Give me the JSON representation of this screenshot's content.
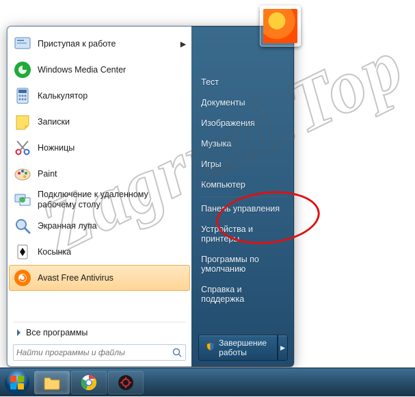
{
  "left_panel": {
    "items": [
      {
        "label": "Приступая к работе",
        "has_submenu": true
      },
      {
        "label": "Windows Media Center"
      },
      {
        "label": "Калькулятор"
      },
      {
        "label": "Записки"
      },
      {
        "label": "Ножницы"
      },
      {
        "label": "Paint"
      },
      {
        "label": "Подключение к удаленному рабочему столу"
      },
      {
        "label": "Экранная лупа"
      },
      {
        "label": "Косынка"
      },
      {
        "label": "Avast Free Antivirus",
        "hovered": true
      }
    ],
    "all_programs": "Все программы",
    "search_placeholder": "Найти программы и файлы"
  },
  "right_panel": {
    "items_a": [
      "Тест",
      "Документы",
      "Изображения",
      "Музыка",
      "Игры",
      "Компьютер"
    ],
    "items_b": [
      "Панель управления",
      "Устройства и принтеры",
      "Программы по умолчанию",
      "Справка и поддержка"
    ],
    "shutdown_label": "Завершение работы"
  },
  "watermark": "Zagruzi.Top"
}
